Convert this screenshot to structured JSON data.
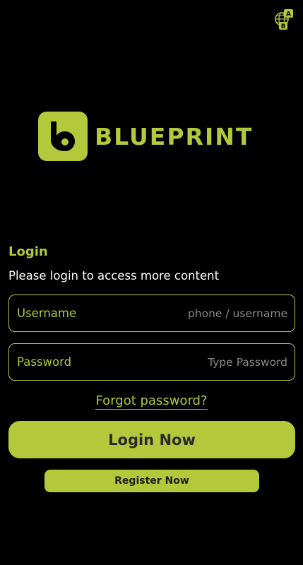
{
  "colors": {
    "background": "#000000",
    "accent": "#b3c83a",
    "text_primary": "#ffffff",
    "placeholder": "#8a8a8a",
    "button_text": "#2b2b2b"
  },
  "header": {
    "language_button": {
      "icon": "language-translate-icon",
      "letter_a": "A",
      "letter_b": "B"
    }
  },
  "brand": {
    "logo_icon": "blueprint-b-logo-icon",
    "name": "BLUEPRINT"
  },
  "login": {
    "title": "Login",
    "subtitle": "Please login to access more content",
    "username": {
      "label": "Username",
      "value": "",
      "placeholder": "phone / username"
    },
    "password": {
      "label": "Password",
      "value": "",
      "placeholder": "Type Password"
    },
    "forgot_link": "Forgot password?",
    "login_button": "Login Now",
    "register_button": "Register Now"
  }
}
